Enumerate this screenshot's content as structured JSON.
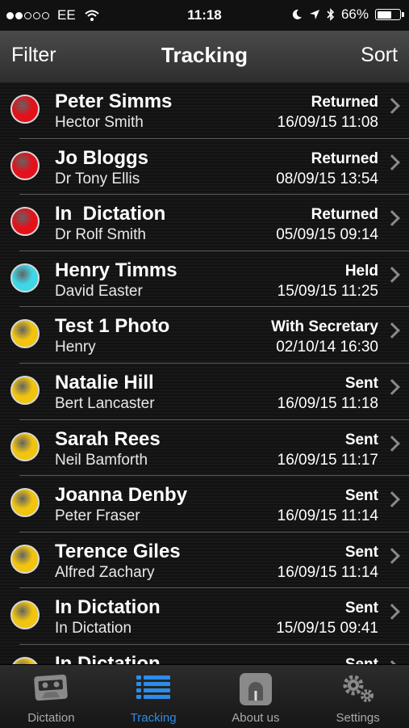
{
  "status_bar": {
    "carrier": "EE",
    "time": "11:18",
    "battery": "66%",
    "battery_level": 0.66
  },
  "nav": {
    "left": "Filter",
    "title": "Tracking",
    "right": "Sort"
  },
  "rows": [
    {
      "name": "Peter Simms",
      "sub": "Hector Smith",
      "status": "Returned",
      "date": "16/09/15 11:08",
      "color": "#e3111b"
    },
    {
      "name": "Jo Bloggs",
      "sub": "Dr Tony Ellis",
      "status": "Returned",
      "date": "08/09/15 13:54",
      "color": "#e3111b"
    },
    {
      "name": "In  Dictation",
      "sub": "Dr Rolf Smith",
      "status": "Returned",
      "date": "05/09/15 09:14",
      "color": "#e3111b"
    },
    {
      "name": "Henry Timms",
      "sub": "David Easter",
      "status": "Held",
      "date": "15/09/15 11:25",
      "color": "#3fd6e8"
    },
    {
      "name": "Test 1 Photo",
      "sub": "Henry",
      "status": "With Secretary",
      "date": "02/10/14 16:30",
      "color": "#f1c40f"
    },
    {
      "name": "Natalie Hill",
      "sub": "Bert Lancaster",
      "status": "Sent",
      "date": "16/09/15 11:18",
      "color": "#f1c40f"
    },
    {
      "name": "Sarah Rees",
      "sub": "Neil Bamforth",
      "status": "Sent",
      "date": "16/09/15 11:17",
      "color": "#f1c40f"
    },
    {
      "name": "Joanna Denby",
      "sub": "Peter Fraser",
      "status": "Sent",
      "date": "16/09/15 11:14",
      "color": "#f1c40f"
    },
    {
      "name": "Terence Giles",
      "sub": "Alfred Zachary",
      "status": "Sent",
      "date": "16/09/15 11:14",
      "color": "#f1c40f"
    },
    {
      "name": "In Dictation",
      "sub": "In Dictation",
      "status": "Sent",
      "date": "15/09/15 09:41",
      "color": "#f1c40f"
    },
    {
      "name": "In Dictation",
      "sub": "",
      "status": "Sent",
      "date": "",
      "color": "#f1c40f"
    }
  ],
  "tabs": [
    {
      "label": "Dictation",
      "icon": "cassette-icon",
      "active": false
    },
    {
      "label": "Tracking",
      "icon": "list-icon",
      "active": true
    },
    {
      "label": "About us",
      "icon": "about-icon",
      "active": false
    },
    {
      "label": "Settings",
      "icon": "gears-icon",
      "active": false
    }
  ],
  "colors": {
    "accent": "#2d8ce8",
    "returned": "#e3111b",
    "held": "#3fd6e8",
    "sent": "#f1c40f"
  }
}
